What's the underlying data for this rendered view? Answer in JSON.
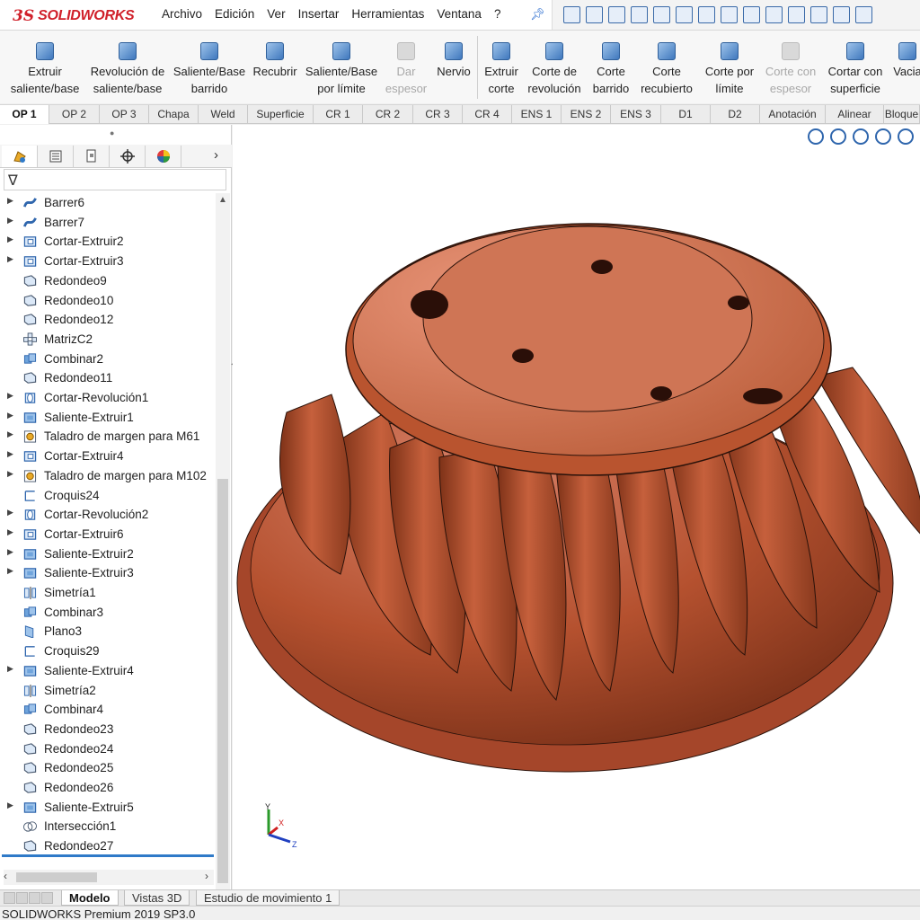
{
  "app": {
    "brand_mark": "3S",
    "brand_name": "SOLIDWORKS"
  },
  "menu": {
    "items": [
      "Archivo",
      "Edición",
      "Ver",
      "Insertar",
      "Herramientas",
      "Ventana",
      "?"
    ]
  },
  "commands": [
    {
      "label": "Extruir\nsaliente/base",
      "enabled": true,
      "icon": "extrude-boss-icon"
    },
    {
      "label": "Revolución de\nsaliente/base",
      "enabled": true,
      "icon": "revolve-boss-icon"
    },
    {
      "label": "Saliente/Base\nbarrido",
      "enabled": true,
      "icon": "swept-boss-icon"
    },
    {
      "label": "Recubrir",
      "enabled": true,
      "icon": "loft-icon"
    },
    {
      "label": "Saliente/Base\npor límite",
      "enabled": true,
      "icon": "boundary-boss-icon"
    },
    {
      "label": "Dar\nespesor",
      "enabled": false,
      "icon": "thicken-icon"
    },
    {
      "label": "Nervio",
      "enabled": true,
      "icon": "rib-icon"
    },
    {
      "label": "Extruir\ncorte",
      "enabled": true,
      "icon": "extrude-cut-icon"
    },
    {
      "label": "Corte de\nrevolución",
      "enabled": true,
      "icon": "revolve-cut-icon"
    },
    {
      "label": "Corte\nbarrido",
      "enabled": true,
      "icon": "swept-cut-icon"
    },
    {
      "label": "Corte\nrecubierto",
      "enabled": true,
      "icon": "lofted-cut-icon"
    },
    {
      "label": "Corte por\nlímite",
      "enabled": true,
      "icon": "boundary-cut-icon"
    },
    {
      "label": "Corte con\nespesor",
      "enabled": false,
      "icon": "thicken-cut-icon"
    },
    {
      "label": "Cortar con\nsuperficie",
      "enabled": true,
      "icon": "cut-with-surface-icon"
    },
    {
      "label": "Vacia",
      "enabled": true,
      "icon": "shell-icon"
    }
  ],
  "tabs": [
    "OP 1",
    "OP 2",
    "OP 3",
    "Chapa",
    "Weld",
    "Superficie",
    "CR 1",
    "CR 2",
    "CR 3",
    "CR 4",
    "ENS 1",
    "ENS 2",
    "ENS 3",
    "D1",
    "D2",
    "Anotación",
    "Alinear",
    "Bloque"
  ],
  "active_tab": "OP 1",
  "feature_tree": [
    {
      "label": "Barrer6",
      "icon": "sweep-icon",
      "expandable": true
    },
    {
      "label": "Barrer7",
      "icon": "sweep-icon",
      "expandable": true
    },
    {
      "label": "Cortar-Extruir2",
      "icon": "cut-extrude-icon",
      "expandable": true
    },
    {
      "label": "Cortar-Extruir3",
      "icon": "cut-extrude-icon",
      "expandable": true
    },
    {
      "label": "Redondeo9",
      "icon": "fillet-icon",
      "expandable": false
    },
    {
      "label": "Redondeo10",
      "icon": "fillet-icon",
      "expandable": false
    },
    {
      "label": "Redondeo12",
      "icon": "fillet-icon",
      "expandable": false
    },
    {
      "label": "MatrizC2",
      "icon": "circular-pattern-icon",
      "expandable": false
    },
    {
      "label": "Combinar2",
      "icon": "combine-icon",
      "expandable": false
    },
    {
      "label": "Redondeo11",
      "icon": "fillet-icon",
      "expandable": false
    },
    {
      "label": "Cortar-Revolución1",
      "icon": "cut-revolve-icon",
      "expandable": true
    },
    {
      "label": "Saliente-Extruir1",
      "icon": "boss-extrude-icon",
      "expandable": true
    },
    {
      "label": "Taladro de margen para M61",
      "icon": "hole-wizard-icon",
      "expandable": true
    },
    {
      "label": "Cortar-Extruir4",
      "icon": "cut-extrude-icon",
      "expandable": true
    },
    {
      "label": "Taladro de margen para M102",
      "icon": "hole-wizard-icon",
      "expandable": true
    },
    {
      "label": "Croquis24",
      "icon": "sketch-icon",
      "expandable": false
    },
    {
      "label": "Cortar-Revolución2",
      "icon": "cut-revolve-icon",
      "expandable": true
    },
    {
      "label": "Cortar-Extruir6",
      "icon": "cut-extrude-icon",
      "expandable": true
    },
    {
      "label": "Saliente-Extruir2",
      "icon": "boss-extrude-icon",
      "expandable": true
    },
    {
      "label": "Saliente-Extruir3",
      "icon": "boss-extrude-icon",
      "expandable": true
    },
    {
      "label": "Simetría1",
      "icon": "mirror-icon",
      "expandable": false
    },
    {
      "label": "Combinar3",
      "icon": "combine-icon",
      "expandable": false
    },
    {
      "label": "Plano3",
      "icon": "plane-icon",
      "expandable": false
    },
    {
      "label": "Croquis29",
      "icon": "sketch-icon",
      "expandable": false
    },
    {
      "label": "Saliente-Extruir4",
      "icon": "boss-extrude-icon",
      "expandable": true
    },
    {
      "label": "Simetría2",
      "icon": "mirror-icon",
      "expandable": false
    },
    {
      "label": "Combinar4",
      "icon": "combine-icon",
      "expandable": false
    },
    {
      "label": "Redondeo23",
      "icon": "fillet-icon",
      "expandable": false
    },
    {
      "label": "Redondeo24",
      "icon": "fillet-icon",
      "expandable": false
    },
    {
      "label": "Redondeo25",
      "icon": "fillet-icon",
      "expandable": false
    },
    {
      "label": "Redondeo26",
      "icon": "fillet-icon",
      "expandable": false
    },
    {
      "label": "Saliente-Extruir5",
      "icon": "boss-extrude-icon",
      "expandable": true
    },
    {
      "label": "Intersección1",
      "icon": "intersect-icon",
      "expandable": false
    },
    {
      "label": "Redondeo27",
      "icon": "fillet-icon",
      "expandable": false
    }
  ],
  "bottom_tabs": [
    "Modelo",
    "Vistas 3D",
    "Estudio de movimiento 1"
  ],
  "active_bottom_tab": "Modelo",
  "triad": {
    "y": "Y",
    "x": "X",
    "z": "Z"
  },
  "status": {
    "text": "SOLIDWORKS Premium 2019 SP3.0"
  },
  "colors": {
    "brand": "#d0202a",
    "accent": "#2f7ac8",
    "model": "#b5512f"
  }
}
